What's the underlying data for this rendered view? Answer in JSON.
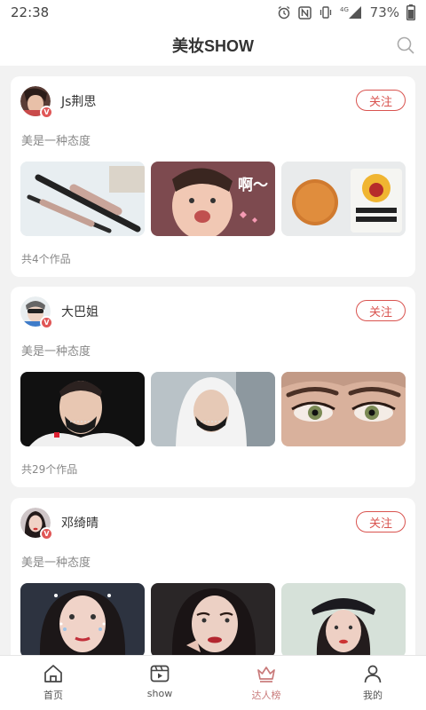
{
  "status_bar": {
    "time": "22:38",
    "network": "4G",
    "battery": "73%"
  },
  "header": {
    "title": "美妆SHOW"
  },
  "feed": [
    {
      "name": "Js荆思",
      "follow_label": "关注",
      "bio": "美是一种态度",
      "count": "共4个作品",
      "speech_text": "啊～"
    },
    {
      "name": "大巴姐",
      "follow_label": "关注",
      "bio": "美是一种态度",
      "count": "共29个作品"
    },
    {
      "name": "邓绮晴",
      "follow_label": "关注",
      "bio": "美是一种态度"
    }
  ],
  "tabs": [
    {
      "label": "首页",
      "icon": "home-icon"
    },
    {
      "label": "show",
      "icon": "video-icon"
    },
    {
      "label": "达人榜",
      "icon": "crown-icon",
      "active": true
    },
    {
      "label": "我的",
      "icon": "user-icon"
    }
  ],
  "colors": {
    "accent": "#d9534f",
    "active_tab": "#c97a7a",
    "background": "#f2f2f2"
  }
}
